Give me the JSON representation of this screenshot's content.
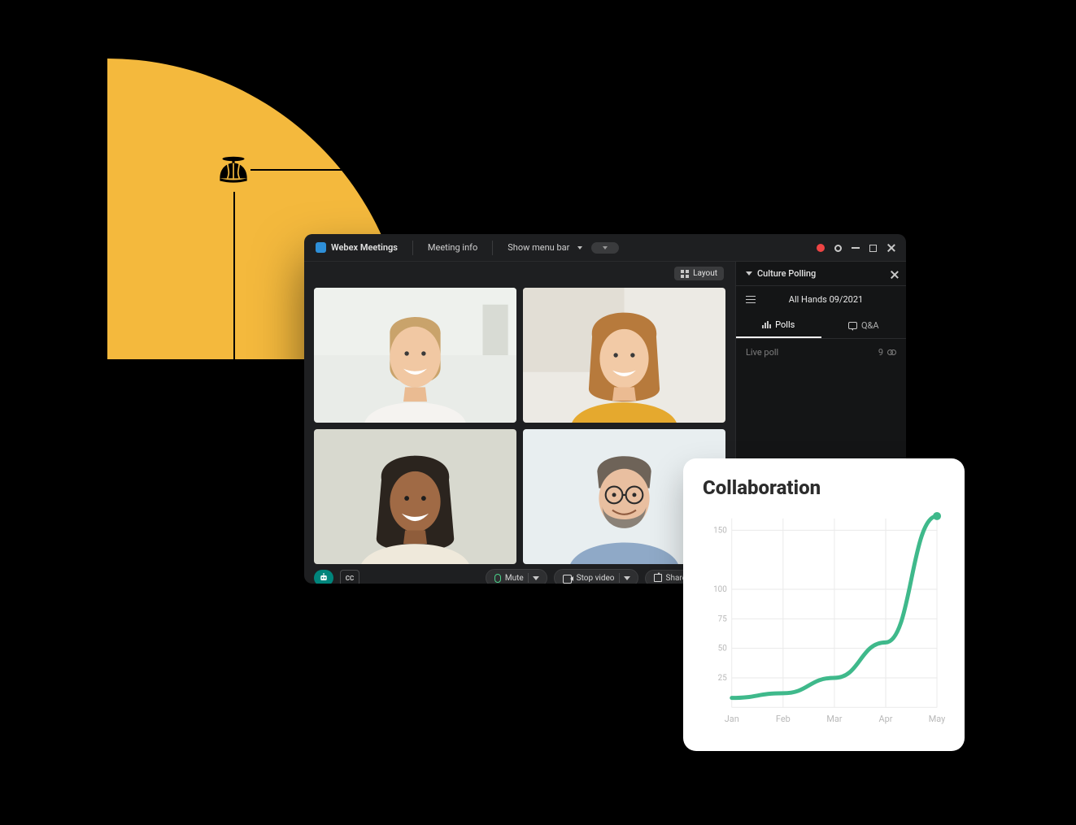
{
  "decor": {
    "beanie_icon_name": "propeller-cap-icon"
  },
  "webex": {
    "brand": "Webex Meetings",
    "menu": {
      "meeting_info": "Meeting info",
      "show_menu_bar": "Show menu bar"
    },
    "layout_btn": "Layout",
    "controls": {
      "mute": "Mute",
      "stop_video": "Stop video",
      "share": "Share",
      "cc": "CC"
    },
    "sidebar": {
      "header": "Culture Polling",
      "title": "All Hands 09/2021",
      "tabs": {
        "polls": "Polls",
        "qa": "Q&A"
      },
      "live_poll": {
        "label": "Live poll",
        "count": "9"
      }
    }
  },
  "collab": {
    "title": "Collaboration"
  },
  "chart_data": {
    "type": "line",
    "title": "Collaboration",
    "xlabel": "",
    "ylabel": "",
    "categories": [
      "Jan",
      "Feb",
      "Mar",
      "Apr",
      "May"
    ],
    "values": [
      8,
      12,
      25,
      55,
      162
    ],
    "ylim": [
      0,
      160
    ],
    "yticks": [
      25,
      50,
      75,
      100,
      150
    ],
    "grid": true
  }
}
